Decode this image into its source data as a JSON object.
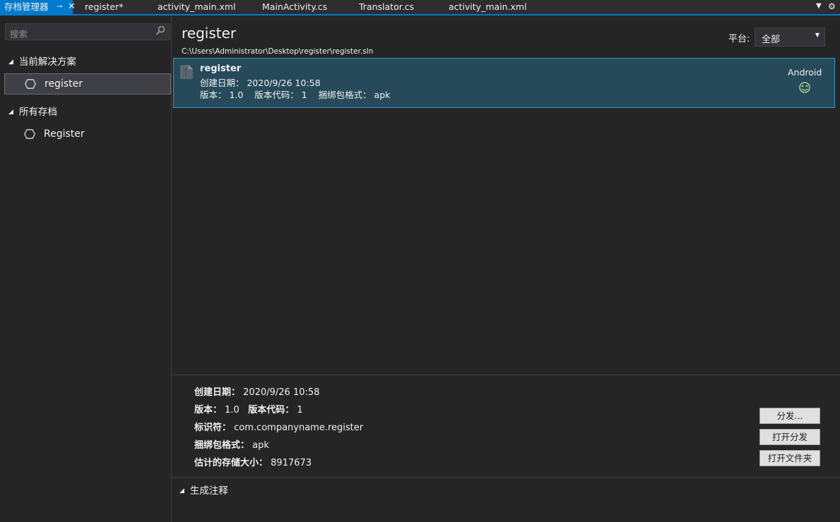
{
  "tabs": [
    {
      "label": "存档管理器",
      "active": true
    },
    {
      "label": "register*"
    },
    {
      "label": "activity_main.xml"
    },
    {
      "label": "MainActivity.cs"
    },
    {
      "label": "Translator.cs"
    },
    {
      "label": "activity_main.xml"
    }
  ],
  "sidebar": {
    "search_placeholder": "搜索",
    "groups": [
      {
        "label": "当前解决方案",
        "items": [
          {
            "label": "register",
            "selected": true
          }
        ]
      },
      {
        "label": "所有存档",
        "items": [
          {
            "label": "Register"
          }
        ]
      }
    ]
  },
  "main": {
    "title": "register",
    "path": "C:\\Users\\Administrator\\Desktop\\register\\register.sln",
    "platform_label": "平台:",
    "platform_value": "全部",
    "archive": {
      "name": "register",
      "date": "创建日期： 2020/9/26 10:58",
      "meta": "版本： 1.0    版本代码： 1    捆绑包格式： apk",
      "platform": "Android"
    },
    "details": {
      "created_label": "创建日期：",
      "created_value": "2020/9/26 10:58",
      "version_label": "版本：",
      "version_value": "1.0",
      "version_code_label": "版本代码：",
      "version_code_value": "1",
      "identifier_label": "标识符：",
      "identifier_value": "com.companyname.register",
      "bundle_label": "捆绑包格式：",
      "bundle_value": "apk",
      "size_label": "估计的存储大小：",
      "size_value": "8917673"
    },
    "buttons": {
      "distribute": "分发...",
      "open_distribution": "打开分发",
      "open_folder": "打开文件夹"
    },
    "notes_label": "生成注释"
  },
  "colors": {
    "accent": "#007acc",
    "background": "#252526",
    "selection": "#264a5a"
  }
}
